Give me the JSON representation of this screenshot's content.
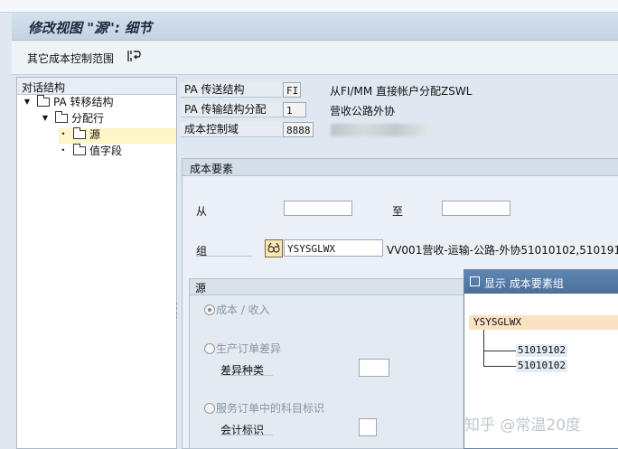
{
  "window": {
    "title": "修改视图 \"源\": 细节"
  },
  "toolbar": {
    "other_scope_label": "其它成本控制范围",
    "icon": "sap-icon"
  },
  "tree": {
    "header": "对话结构",
    "items": [
      {
        "label": "PA 转移结构",
        "state": "expanded"
      },
      {
        "label": "分配行",
        "state": "expanded"
      },
      {
        "label": "源",
        "state": "selected"
      },
      {
        "label": "值字段",
        "state": "leaf"
      }
    ]
  },
  "fields": {
    "transfer_structure": {
      "label": "PA 传送结构",
      "value": "FI",
      "description": "从FI/MM 直接帐户分配ZSWL"
    },
    "transfer_assignment": {
      "label": "PA 传输结构分配",
      "value": "1",
      "description": "营收公路外协"
    },
    "controlling_area": {
      "label": "成本控制域",
      "value": "8888"
    }
  },
  "cost_elements": {
    "section_title": "成本要素",
    "from_label": "从",
    "from_value": "",
    "to_label": "至",
    "to_value": "",
    "group_label": "组",
    "group_value": "YSYSGLWX",
    "group_description": "VV001营收-运输-公路-外协51010102,5101910"
  },
  "source": {
    "section_title": "源",
    "options": [
      {
        "label": "成本 / 收入",
        "selected": true
      },
      {
        "label": "生产订单差异",
        "selected": false,
        "sub_label": "差异种类",
        "sub_value": ""
      },
      {
        "label": "服务订单中的科目标识",
        "selected": false,
        "sub_label": "会计标识",
        "sub_value": ""
      }
    ]
  },
  "popup": {
    "title": "显示 成本要素组",
    "root": "YSYSGLWX",
    "children": [
      "51019102",
      "51010102"
    ]
  },
  "watermark": "知乎 @常温20度",
  "colors": {
    "title_bar": "#c4d3e3",
    "selection": "#fff6c8",
    "popup_header": "#4a6f9b",
    "popup_root": "#fbe2c4"
  }
}
